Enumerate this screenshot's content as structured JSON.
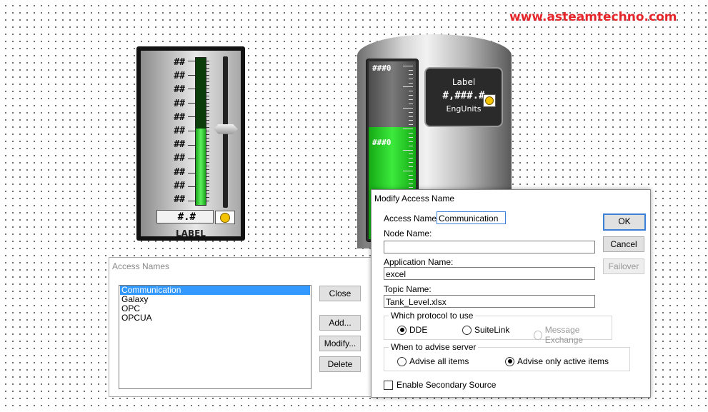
{
  "watermark": "www.asteamtechno.com",
  "slider_widget": {
    "scale_labels": [
      "##",
      "##",
      "##",
      "##",
      "##",
      "##",
      "##",
      "##",
      "##",
      "##",
      "##"
    ],
    "value_text": "#.#",
    "label": "LABEL",
    "fill_percent": 52,
    "thumb_percent": 52
  },
  "tank_widget": {
    "top_scale": "###0",
    "mid_scale": "###0",
    "fill_percent": 63,
    "panel": {
      "label": "Label",
      "value": "#,###.#",
      "units": "EngUnits"
    }
  },
  "access_names_dialog": {
    "title": "Access Names",
    "items": [
      {
        "name": "Communication",
        "selected": true
      },
      {
        "name": "Galaxy",
        "selected": false
      },
      {
        "name": "OPC",
        "selected": false
      },
      {
        "name": "OPCUA",
        "selected": false
      }
    ],
    "buttons": {
      "close": "Close",
      "add": "Add...",
      "modify": "Modify...",
      "delete": "Delete"
    }
  },
  "modify_dialog": {
    "title": "Modify Access Name",
    "access_name_label": "Access Name:",
    "access_name_value": "Communication",
    "node_name_label": "Node Name:",
    "node_name_value": "",
    "application_name_label": "Application Name:",
    "application_name_value": "excel",
    "topic_name_label": "Topic Name:",
    "topic_name_value": "Tank_Level.xlsx",
    "protocol_group": {
      "title": "Which protocol to use",
      "options": [
        {
          "label": "DDE",
          "selected": true,
          "enabled": true
        },
        {
          "label": "SuiteLink",
          "selected": false,
          "enabled": true
        },
        {
          "label": "Message Exchange",
          "selected": false,
          "enabled": false
        }
      ]
    },
    "advise_group": {
      "title": "When to advise server",
      "options": [
        {
          "label": "Advise all items",
          "selected": false
        },
        {
          "label": "Advise only active items",
          "selected": true
        }
      ]
    },
    "secondary_source_label": "Enable Secondary Source",
    "secondary_source_checked": false,
    "buttons": {
      "ok": "OK",
      "cancel": "Cancel",
      "failover": "Failover"
    }
  }
}
